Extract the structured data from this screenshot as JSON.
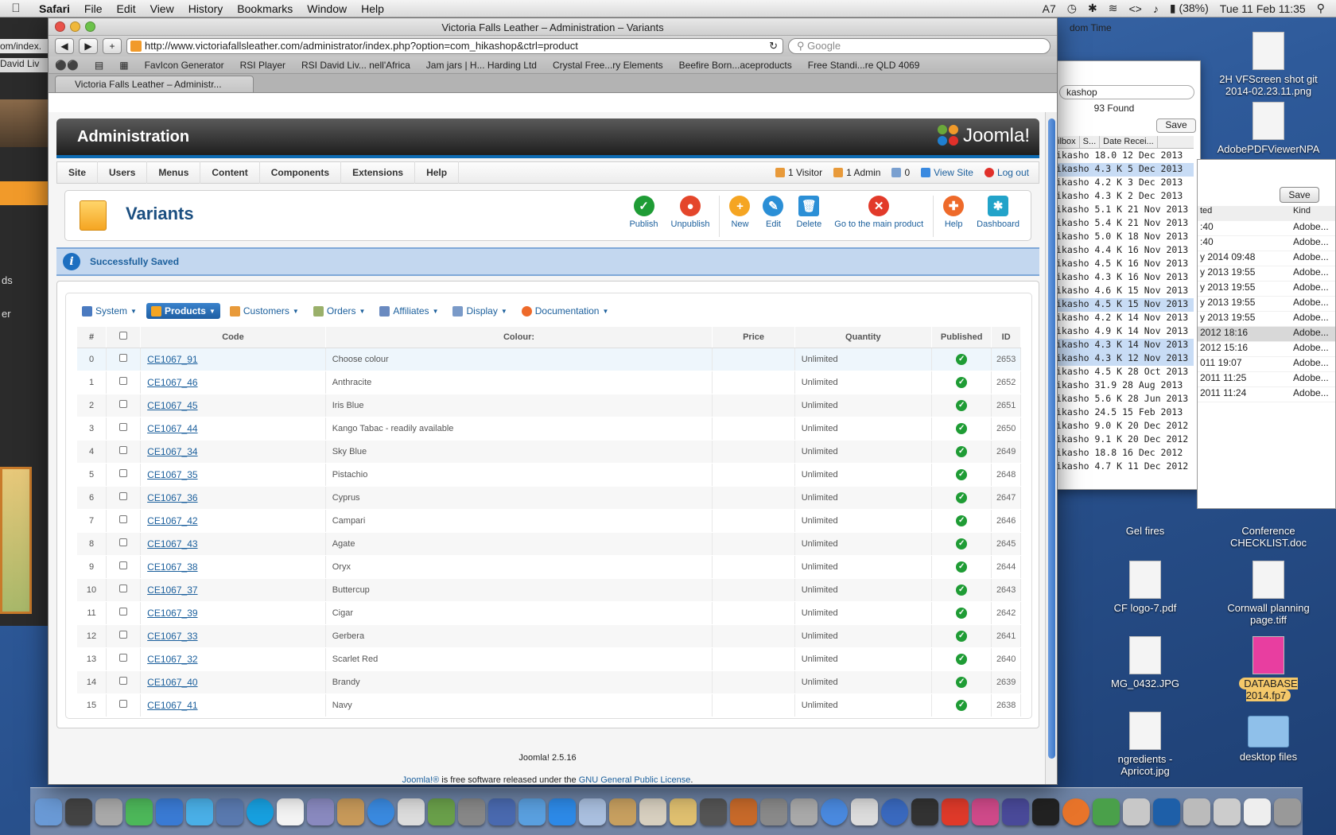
{
  "menubar": {
    "app": "Safari",
    "items": [
      "File",
      "Edit",
      "View",
      "History",
      "Bookmarks",
      "Window",
      "Help"
    ],
    "battery": "(38%)",
    "clock": "Tue 11 Feb  11:35",
    "indicator": "7"
  },
  "background": {
    "left_url": "om/index.",
    "left_tab": "David Liv",
    "left_labels": [
      "ds",
      "er"
    ],
    "mail_search": "kashop",
    "mail_found": "93 Found",
    "mail_save": "Save",
    "mail_cols": [
      "ilbox",
      "S...",
      "Date Recei..."
    ],
    "mail_rows": [
      "ikasho 18.0  12 Dec 2013",
      "ikasho 4.3 K  5 Dec 2013",
      "ikasho 4.2 K  3 Dec 2013",
      "ikasho 4.3 K  2 Dec 2013",
      "ikasho 5.1 K 21 Nov 2013",
      "ikasho 5.4 K 21 Nov 2013",
      "ikasho 5.0 K 18 Nov 2013",
      "ikasho 4.4 K 16 Nov 2013",
      "ikasho 4.5 K 16 Nov 2013",
      "ikasho 4.3 K 16 Nov 2013",
      "ikasho 4.6 K 15 Nov 2013",
      "ikasho 4.5 K 15 Nov 2013",
      "ikasho 4.2 K 14 Nov 2013",
      "ikasho 4.9 K 14 Nov 2013",
      "ikasho 4.3 K 14 Nov 2013",
      "ikasho 4.3 K 12 Nov 2013",
      "ikasho 4.5 K 28 Oct 2013",
      "ikasho 31.9  28 Aug 2013",
      "ikasho 5.6 K 28 Jun 2013",
      "ikasho 24.5  15 Feb 2013",
      "ikasho 9.0 K 20 Dec 2012",
      "ikasho 9.1 K 20 Dec 2012",
      "ikasho 18.8  16 Dec 2012",
      "ikasho 4.7 K 11 Dec 2012"
    ],
    "finder_save": "Save",
    "finder_cols": [
      "ted",
      "Kind"
    ],
    "finder_rows": [
      [
        ":40",
        "Adobe..."
      ],
      [
        ":40",
        "Adobe..."
      ],
      [
        "y 2014 09:48",
        "Adobe..."
      ],
      [
        "y 2013 19:55",
        "Adobe..."
      ],
      [
        "y 2013 19:55",
        "Adobe..."
      ],
      [
        "y 2013 19:55",
        "Adobe..."
      ],
      [
        "y 2013 19:55",
        "Adobe..."
      ],
      [
        " 2012 18:16",
        "Adobe..."
      ],
      [
        " 2012 15:16",
        "Adobe..."
      ],
      [
        "011 19:07",
        "Adobe..."
      ],
      [
        "2011 11:25",
        "Adobe..."
      ],
      [
        "2011 11:24",
        "Adobe..."
      ]
    ],
    "top_label": "dom Time",
    "desktop_icons": [
      "2H VFScreen shot git 2014-02.23.11.png",
      "AdobePDFViewerNPA",
      "Gel fires",
      "Conference CHECKLIST.doc",
      "CF logo-7.pdf",
      "Cornwall planning page.tiff",
      "MG_0432.JPG",
      "DATABASE 2014.fp7",
      "ngredients - Apricot.jpg",
      "desktop files"
    ]
  },
  "safari": {
    "window_title": "Victoria Falls Leather – Administration – Variants",
    "url": "http://www.victoriafallsleather.com/administrator/index.php?option=com_hikashop&ctrl=product",
    "search_placeholder": "Google",
    "bookmarks": [
      "FavIcon Generator",
      "RSI Player",
      "RSI David Liv... nell'Africa",
      "Jam jars | H... Harding Ltd",
      "Crystal Free...ry Elements",
      "Beefire Born...aceproducts",
      "Free Standi...re QLD 4069"
    ],
    "tab_title": "Victoria Falls Leather – Administr..."
  },
  "admin": {
    "header_title": "Administration",
    "logo_text": "Joomla!",
    "menu": [
      "Site",
      "Users",
      "Menus",
      "Content",
      "Components",
      "Extensions",
      "Help"
    ],
    "status": {
      "visitors": "1 Visitor",
      "admins": "1 Admin",
      "messages": "0",
      "view_site": "View Site",
      "logout": "Log out"
    },
    "page_title": "Variants",
    "toolbar": {
      "publish": "Publish",
      "unpublish": "Unpublish",
      "new": "New",
      "edit": "Edit",
      "delete": "Delete",
      "main_product": "Go to the main product",
      "help": "Help",
      "dashboard": "Dashboard"
    },
    "message": "Successfully Saved",
    "submenu": [
      "System",
      "Products",
      "Customers",
      "Orders",
      "Affiliates",
      "Display",
      "Documentation"
    ],
    "columns": {
      "num": "#",
      "code": "Code",
      "colour": "Colour:",
      "price": "Price",
      "quantity": "Quantity",
      "published": "Published",
      "id": "ID"
    },
    "rows": [
      {
        "n": "0",
        "code": "CE1067_91",
        "colour": "Choose colour",
        "price": "",
        "qty": "Unlimited",
        "id": "2653"
      },
      {
        "n": "1",
        "code": "CE1067_46",
        "colour": "Anthracite",
        "price": "",
        "qty": "Unlimited",
        "id": "2652"
      },
      {
        "n": "2",
        "code": "CE1067_45",
        "colour": "Iris Blue",
        "price": "",
        "qty": "Unlimited",
        "id": "2651"
      },
      {
        "n": "3",
        "code": "CE1067_44",
        "colour": "Kango Tabac - readily available",
        "price": "",
        "qty": "Unlimited",
        "id": "2650"
      },
      {
        "n": "4",
        "code": "CE1067_34",
        "colour": "Sky Blue",
        "price": "",
        "qty": "Unlimited",
        "id": "2649"
      },
      {
        "n": "5",
        "code": "CE1067_35",
        "colour": "Pistachio",
        "price": "",
        "qty": "Unlimited",
        "id": "2648"
      },
      {
        "n": "6",
        "code": "CE1067_36",
        "colour": "Cyprus",
        "price": "",
        "qty": "Unlimited",
        "id": "2647"
      },
      {
        "n": "7",
        "code": "CE1067_42",
        "colour": "Campari",
        "price": "",
        "qty": "Unlimited",
        "id": "2646"
      },
      {
        "n": "8",
        "code": "CE1067_43",
        "colour": "Agate",
        "price": "",
        "qty": "Unlimited",
        "id": "2645"
      },
      {
        "n": "9",
        "code": "CE1067_38",
        "colour": "Oryx",
        "price": "",
        "qty": "Unlimited",
        "id": "2644"
      },
      {
        "n": "10",
        "code": "CE1067_37",
        "colour": "Buttercup",
        "price": "",
        "qty": "Unlimited",
        "id": "2643"
      },
      {
        "n": "11",
        "code": "CE1067_39",
        "colour": "Cigar",
        "price": "",
        "qty": "Unlimited",
        "id": "2642"
      },
      {
        "n": "12",
        "code": "CE1067_33",
        "colour": "Gerbera",
        "price": "",
        "qty": "Unlimited",
        "id": "2641"
      },
      {
        "n": "13",
        "code": "CE1067_32",
        "colour": "Scarlet Red",
        "price": "",
        "qty": "Unlimited",
        "id": "2640"
      },
      {
        "n": "14",
        "code": "CE1067_40",
        "colour": "Brandy",
        "price": "",
        "qty": "Unlimited",
        "id": "2639"
      },
      {
        "n": "15",
        "code": "CE1067_41",
        "colour": "Navy",
        "price": "",
        "qty": "Unlimited",
        "id": "2638"
      }
    ],
    "footer_version": "Joomla! 2.5.16",
    "footer_license_pre": "Joomla!®",
    "footer_license_mid": " is free software released under the ",
    "footer_license_link": "GNU General Public License",
    "footer_license_post": "."
  },
  "colors": {
    "accent": "#1b5f9c",
    "publish": "#1f9c35",
    "unpublish": "#e4462b",
    "new": "#f5a522",
    "edit": "#2b8fd6",
    "delete": "#2b8fd6",
    "main_product": "#e23a2a",
    "help": "#ee6a2a",
    "dashboard": "#22a3c9"
  }
}
